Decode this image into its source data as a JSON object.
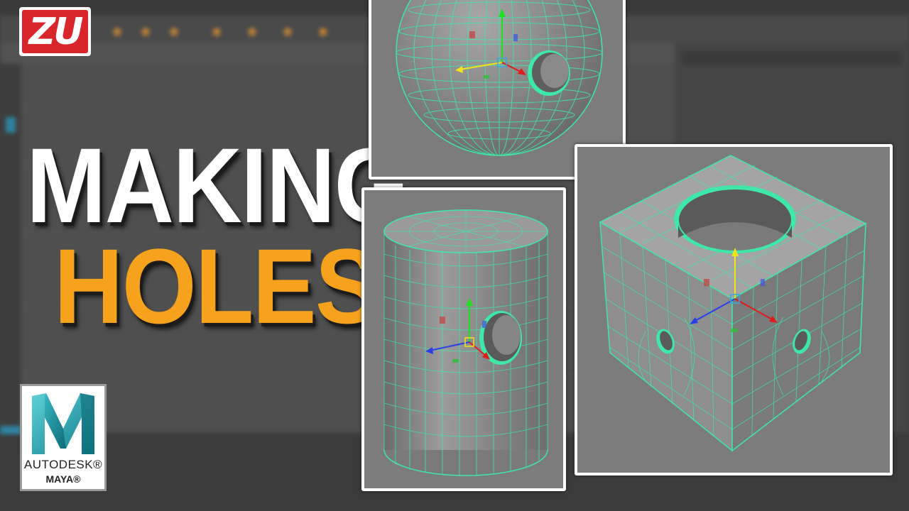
{
  "logo_top": {
    "text": "ZU",
    "color": "#d8262b"
  },
  "title": {
    "line1": "MAKING",
    "line2": "HOLES",
    "line1_color": "#ffffff",
    "line2_color": "#f6a21c"
  },
  "maya_logo": {
    "brand": "AUTODESK®",
    "product": "MAYA®"
  },
  "panels": [
    {
      "name": "sphere-with-hole"
    },
    {
      "name": "cylinder-with-hole"
    },
    {
      "name": "cube-with-holes"
    }
  ],
  "colors": {
    "wireframe": "#3fe8a8",
    "mesh_surface": "#8c8c8c",
    "viewport_bg": "#7a7a7a",
    "axis_x": "#e01b1b",
    "axis_y": "#1ee01e",
    "axis_z": "#2a3fe8",
    "axis_yellow": "#f2e41a"
  }
}
